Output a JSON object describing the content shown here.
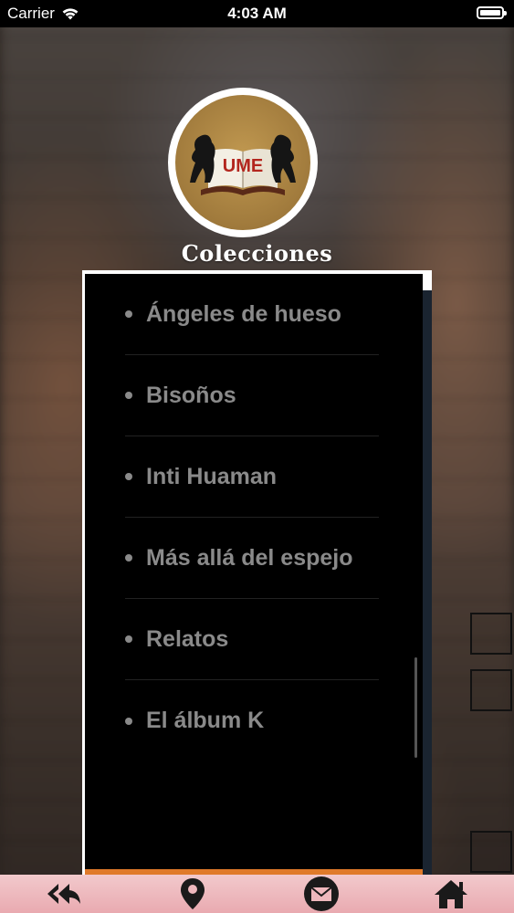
{
  "status_bar": {
    "carrier": "Carrier",
    "time": "4:03 AM"
  },
  "logo": {
    "text": "UME"
  },
  "title": "Colecciones",
  "collections": [
    {
      "label": "Ángeles de hueso"
    },
    {
      "label": "Bisoños"
    },
    {
      "label": "Inti Huaman"
    },
    {
      "label": "Más allá del espejo"
    },
    {
      "label": "Relatos"
    },
    {
      "label": "El álbum K"
    }
  ],
  "bottom_nav": {
    "icons": [
      "reply-all-icon",
      "map-pin-icon",
      "mail-icon",
      "home-icon"
    ]
  },
  "colors": {
    "accent": "#e07a2a",
    "bottom_bar": "#eeb8bd",
    "list_text": "#8a8a8a"
  }
}
